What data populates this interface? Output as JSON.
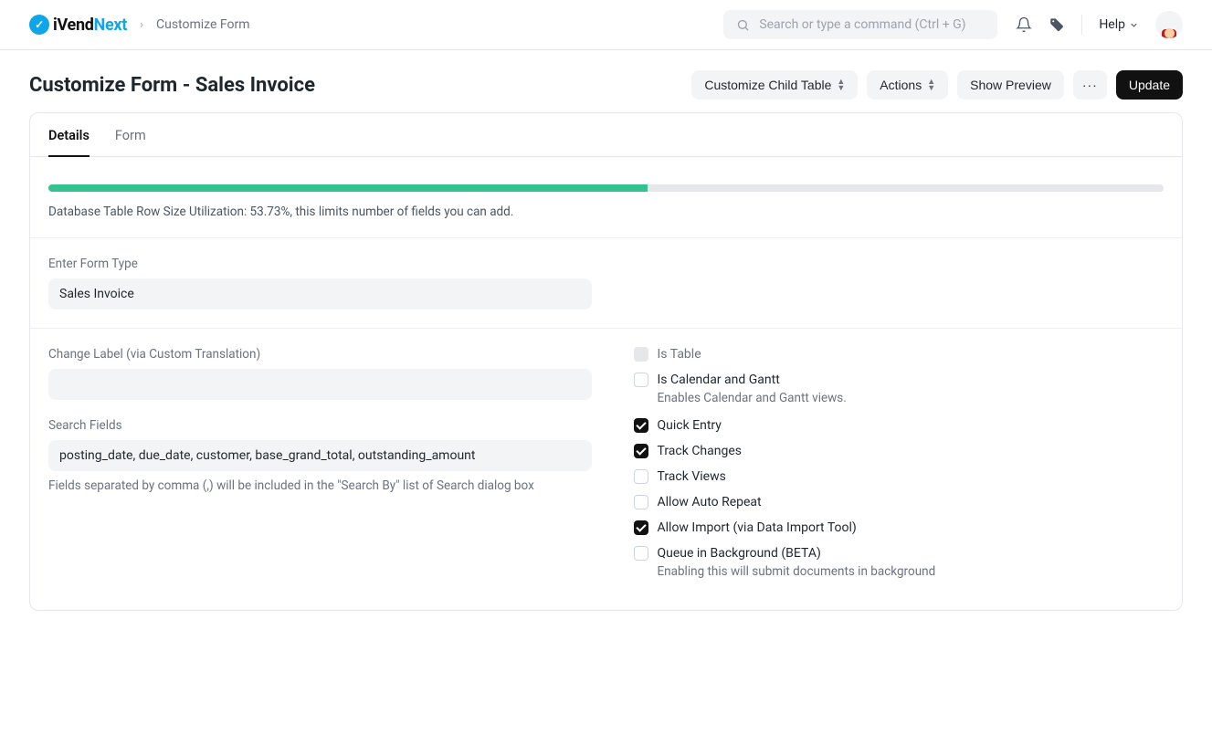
{
  "brand": {
    "black": "iVend",
    "blue": "Next"
  },
  "breadcrumb": "Customize Form",
  "search": {
    "placeholder": "Search or type a command (Ctrl + G)"
  },
  "help_label": "Help",
  "page_title": "Customize Form - Sales Invoice",
  "actions": {
    "customize_child": "Customize Child Table",
    "actions": "Actions",
    "show_preview": "Show Preview",
    "update": "Update"
  },
  "tabs": {
    "details": "Details",
    "form": "Form"
  },
  "progress": {
    "percent": 53.73,
    "text": "Database Table Row Size Utilization: 53.73%, this limits number of fields you can add."
  },
  "form_type": {
    "label": "Enter Form Type",
    "value": "Sales Invoice"
  },
  "change_label": {
    "label": "Change Label (via Custom Translation)",
    "value": ""
  },
  "search_fields": {
    "label": "Search Fields",
    "value": "posting_date, due_date, customer, base_grand_total, outstanding_amount",
    "help": "Fields separated by comma (,) will be included in the \"Search By\" list of Search dialog box"
  },
  "checks": {
    "is_table": {
      "label": "Is Table",
      "state": "disabled"
    },
    "is_calendar": {
      "label": "Is Calendar and Gantt",
      "state": "empty",
      "help": "Enables Calendar and Gantt views."
    },
    "quick_entry": {
      "label": "Quick Entry",
      "state": "checked"
    },
    "track_changes": {
      "label": "Track Changes",
      "state": "checked"
    },
    "track_views": {
      "label": "Track Views",
      "state": "empty"
    },
    "allow_auto_repeat": {
      "label": "Allow Auto Repeat",
      "state": "empty"
    },
    "allow_import": {
      "label": "Allow Import (via Data Import Tool)",
      "state": "checked"
    },
    "queue_bg": {
      "label": "Queue in Background (BETA)",
      "state": "empty",
      "help": "Enabling this will submit documents in background"
    }
  }
}
